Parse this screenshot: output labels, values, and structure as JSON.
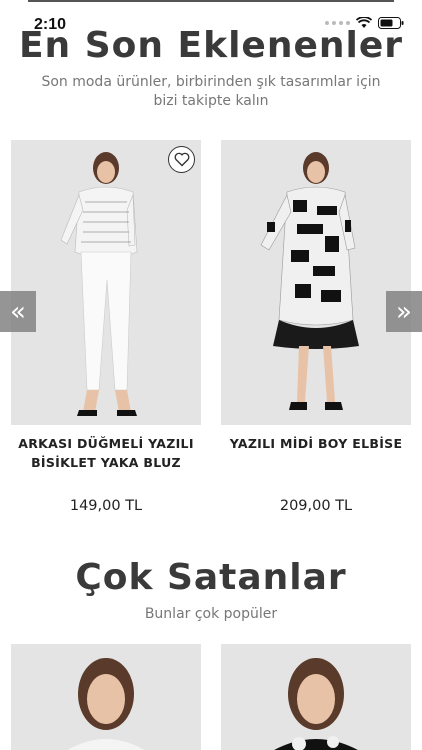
{
  "status": {
    "time": "2:10"
  },
  "new_arrivals": {
    "title": "En Son Eklenenler",
    "subtitle": "Son moda ürünler, birbirinden şık tasarımlar için bizi takipte kalın",
    "products": [
      {
        "name": "ARKASI DÜĞMELİ YAZILI BİSİKLET YAKA BLUZ",
        "price": "149,00 TL"
      },
      {
        "name": "YAZILI MİDİ BOY ELBİSE",
        "price": "209,00 TL"
      }
    ],
    "prev_arrow": "«",
    "next_arrow": "»"
  },
  "best_sellers": {
    "title": "Çok Satanlar",
    "subtitle": "Bunlar çok popüler"
  },
  "colors": {
    "title": "#3a3a3a",
    "arrow_bg": "#828282",
    "image_bg": "#e2e2e2"
  }
}
